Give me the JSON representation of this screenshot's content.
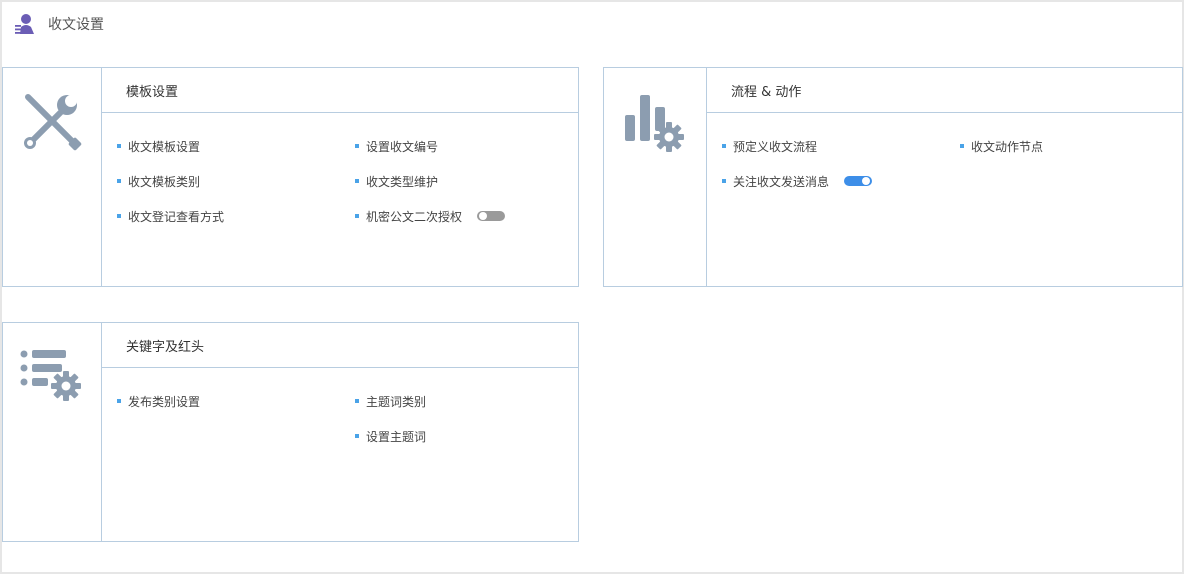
{
  "header": {
    "title": "收文设置",
    "icon": "user-stamp-icon"
  },
  "colors": {
    "accent": "#3d8ee8",
    "bullet": "#4aa3e8",
    "border": "#b8cde0",
    "icon": "#8c9db0",
    "header_icon": "#6b5db5"
  },
  "cards": {
    "template": {
      "title": "模板设置",
      "icon": "wrench-screwdriver-icon",
      "items": [
        {
          "label": "收文模板设置"
        },
        {
          "label": "设置收文编号"
        },
        {
          "label": "收文模板类别"
        },
        {
          "label": "收文类型维护"
        },
        {
          "label": "收文登记查看方式"
        },
        {
          "label": "机密公文二次授权",
          "toggle": "off"
        }
      ]
    },
    "flow": {
      "title": "流程 & 动作",
      "icon": "chart-gear-icon",
      "items": [
        {
          "label": "预定义收文流程"
        },
        {
          "label": "收文动作节点"
        },
        {
          "label": "关注收文发送消息",
          "toggle": "on"
        }
      ]
    },
    "keyword": {
      "title": "关键字及红头",
      "icon": "list-gear-icon",
      "items": [
        {
          "label": "发布类别设置"
        },
        {
          "label": "主题词类别"
        },
        {
          "label": "设置主题词"
        }
      ]
    }
  }
}
